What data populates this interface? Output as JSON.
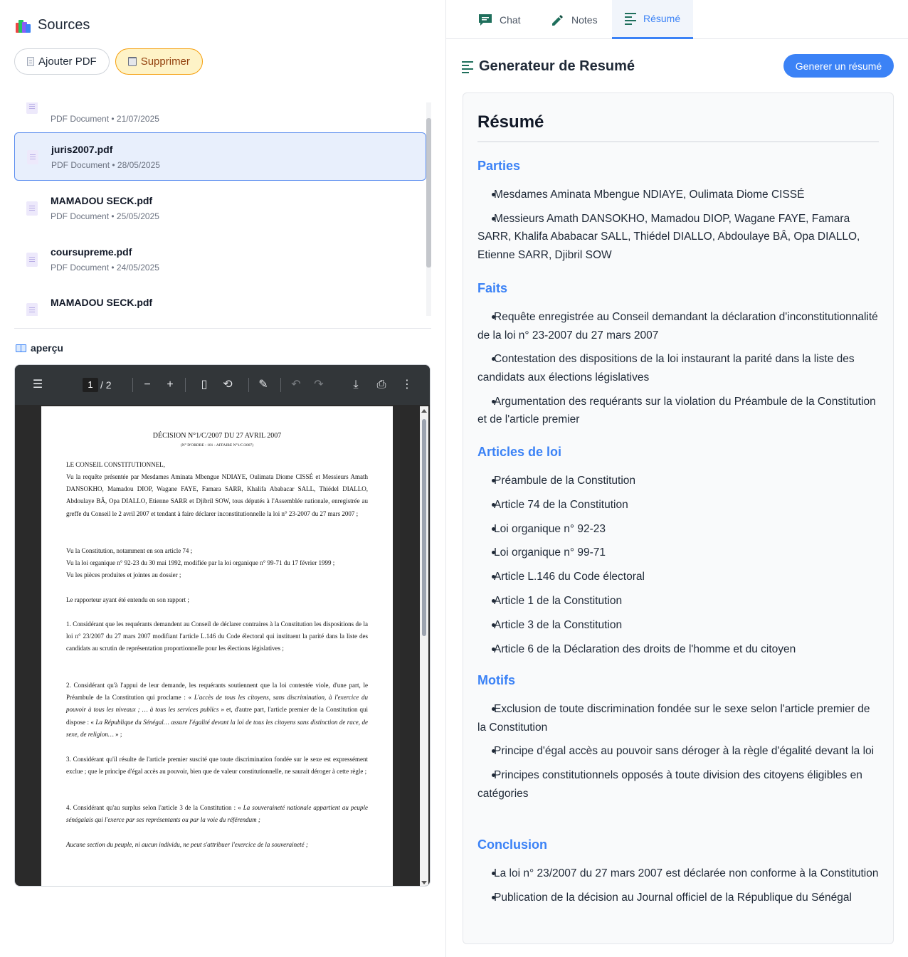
{
  "sources": {
    "title": "Sources",
    "add_pdf": "Ajouter PDF",
    "delete": "Supprimer",
    "files": [
      {
        "name": "",
        "meta": "PDF Document • 21/07/2025"
      },
      {
        "name": "juris2007.pdf",
        "meta": "PDF Document • 28/05/2025"
      },
      {
        "name": "MAMADOU SECK.pdf",
        "meta": "PDF Document • 25/05/2025"
      },
      {
        "name": "coursupreme.pdf",
        "meta": "PDF Document • 24/05/2025"
      },
      {
        "name": "MAMADOU SECK.pdf",
        "meta": ""
      }
    ],
    "preview_label": "aperçu"
  },
  "pdf": {
    "page_current": "1",
    "page_total": "/ 2",
    "title": "DÉCISION N°1/C/2007 DU 27 AVRIL 2007",
    "subtitle": "(N° D'ORDRE : 101 - AFFAIRE N°1/C/2007)",
    "p1": "LE CONSEIL CONSTITUTIONNEL,",
    "p2": "Vu la requête présentée par Mesdames Aminata Mbengue NDIAYE, Oulimata Diome CISSÉ et Messieurs Amath DANSOKHO, Mamadou DIOP, Wagane FAYE, Famara SARR, Khalifa Ababacar SALL, Thiédel DIALLO, Abdoulaye BÂ, Opa DIALLO, Etienne SARR et Djibril SOW, tous députés à l'Assemblée nationale, enregistrée au greffe du Conseil le 2 avril 2007 et tendant à faire déclarer inconstitutionnelle la loi n° 23-2007 du 27 mars 2007 ;",
    "p3": "Vu la Constitution, notamment en son article 74 ;",
    "p4": "Vu la loi organique n° 92-23 du 30 mai 1992, modifiée par la loi organique n° 99-71 du 17 février 1999 ;",
    "p5": "Vu les pièces produites et jointes au dossier ;",
    "p6": "Le rapporteur ayant été entendu en son rapport ;",
    "p7": "1. Considérant que les requérants demandent au Conseil de déclarer contraires à la Constitution les dispositions de la loi n° 23/2007 du 27 mars 2007 modifiant l'article L.146 du Code électoral qui instituent la parité dans la liste des candidats au scrutin de représentation proportionnelle pour les élections législatives ;",
    "p8a": "2. Considérant qu'à l'appui de leur demande, les requérants soutiennent que la loi contestée viole, d'une part, le Préambule de la Constitution qui proclame : « ",
    "p8b": "L'accès de tous les citoyens, sans discrimination, à l'exercice du pouvoir à tous les niveaux ; … à tous les services publics",
    "p8c": " » et, d'autre part, l'article premier de la Constitution qui dispose : « ",
    "p8d": "La République du Sénégal… assure l'égalité devant la loi de tous les citoyens sans distinction de race, de sexe, de religion…",
    "p8e": " » ;",
    "p9": "3. Considérant qu'il résulte de l'article premier suscité que toute discrimination fondée sur le sexe est expressément exclue ; que le principe d'égal accès au pouvoir, bien que de valeur constitutionnelle, ne saurait déroger à cette règle ;",
    "p10a": "4. Considérant qu'au surplus selon l'article 3 de la Constitution : « ",
    "p10b": "La souveraineté nationale appartient au peuple sénégalais qui l'exerce par ses représentants ou par la voie du référendum ;",
    "p11": "Aucune section du peuple, ni aucun individu, ne peut s'attribuer l'exercice de la souveraineté ;"
  },
  "tabs": [
    {
      "label": "Chat",
      "icon": "chat-icon",
      "active": false
    },
    {
      "label": "Notes",
      "icon": "pencil-icon",
      "active": false
    },
    {
      "label": "Résumé",
      "icon": "lines-icon",
      "active": true
    }
  ],
  "generator": {
    "title": "Generateur de Resumé",
    "button": "Generer un résumé"
  },
  "resume": {
    "heading": "Résumé",
    "sections": [
      {
        "title": "Parties",
        "items": [
          "Mesdames Aminata Mbengue NDIAYE, Oulimata Diome CISSÉ",
          "Messieurs Amath DANSOKHO, Mamadou DIOP, Wagane FAYE, Famara SARR, Khalifa Ababacar SALL, Thiédel DIALLO, Abdoulaye BÂ, Opa DIALLO, Etienne SARR, Djibril SOW"
        ]
      },
      {
        "title": "Faits",
        "items": [
          "Requête enregistrée au Conseil demandant la déclaration d'inconstitutionnalité de la loi n° 23-2007 du 27 mars 2007",
          "Contestation des dispositions de la loi instaurant la parité dans la liste des candidats aux élections législatives",
          "Argumentation des requérants sur la violation du Préambule de la Constitution et de l'article premier"
        ]
      },
      {
        "title": "Articles de loi",
        "items": [
          "Préambule de la Constitution",
          "Article 74 de la Constitution",
          "Loi organique n° 92-23",
          "Loi organique n° 99-71",
          "Article L.146 du Code électoral",
          "Article 1 de la Constitution",
          "Article 3 de la Constitution",
          "Article 6 de la Déclaration des droits de l'homme et du citoyen"
        ]
      },
      {
        "title": "Motifs",
        "items": [
          "Exclusion de toute discrimination fondée sur le sexe selon l'article premier de la Constitution",
          "Principe d'égal accès au pouvoir sans déroger à la règle d'égalité devant la loi",
          "Principes constitutionnels opposés à toute division des citoyens éligibles en catégories"
        ]
      },
      {
        "title": "Conclusion",
        "items": [
          "La loi n° 23/2007 du 27 mars 2007 est déclarée non conforme à la Constitution",
          "Publication de la décision au Journal officiel de la République du Sénégal"
        ]
      }
    ]
  },
  "colors": {
    "accent": "#3b82f6",
    "warn_bg": "#fef3c7",
    "warn_border": "#f59e0b",
    "selected_bg": "#e8effc"
  }
}
